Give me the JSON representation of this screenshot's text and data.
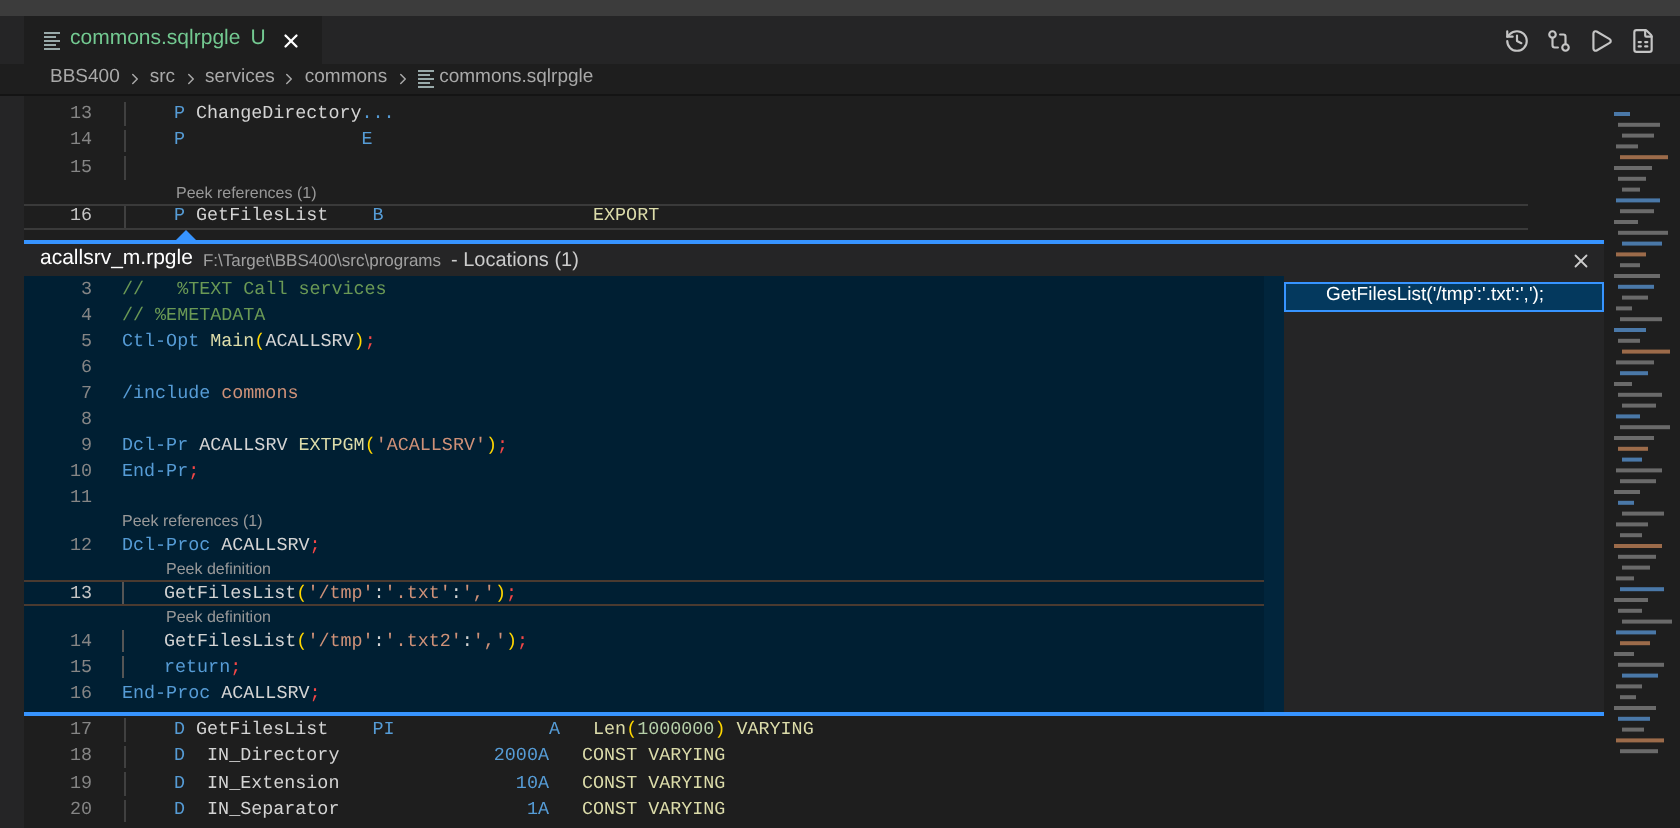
{
  "tab": {
    "title": "commons.sqlrpgle",
    "status": "U",
    "selected": true
  },
  "breadcrumb": [
    "BBS400",
    "src",
    "services",
    "commons",
    "commons.sqlrpgle"
  ],
  "editor_top": {
    "lines": [
      {
        "number": "13",
        "current": false,
        "tokens": [
          {
            "text": "P ",
            "kind": "keyword"
          },
          {
            "text": "ChangeDirectory",
            "kind": "name"
          },
          {
            "text": "...",
            "kind": "keyword"
          }
        ]
      },
      {
        "number": "14",
        "current": false,
        "tokens": [
          {
            "text": "P                E",
            "kind": "keyword"
          }
        ]
      },
      {
        "number": "15",
        "current": false
      },
      {
        "number": "16",
        "current": true,
        "lens": "Peek references (1)",
        "tokens": [
          {
            "text": "P ",
            "kind": "keyword"
          },
          {
            "text": "GetFilesList    ",
            "kind": "name"
          },
          {
            "text": "B",
            "kind": "keyword"
          },
          {
            "text": "                   EXPORT",
            "kind": "attr"
          }
        ]
      }
    ]
  },
  "peek": {
    "file": "acallsrv_m.rpgle",
    "path": "F:\\Target\\BBS400\\src\\programs",
    "title": "- Locations (1)",
    "lines": [
      {
        "number": "3",
        "current": false,
        "nested": false,
        "tokens": [
          {
            "text": "//   %TEXT Call services",
            "kind": "comment"
          }
        ]
      },
      {
        "number": "4",
        "current": false,
        "nested": false,
        "tokens": [
          {
            "text": "// %EMETADATA",
            "kind": "comment"
          }
        ]
      },
      {
        "number": "5",
        "current": false,
        "nested": false,
        "tokens": [
          {
            "text": "Ctl-Opt ",
            "kind": "keyword"
          },
          {
            "text": "Main",
            "kind": "func"
          },
          {
            "text": "(",
            "kind": "paren"
          },
          {
            "text": "ACALLSRV",
            "kind": "name"
          },
          {
            "text": ")",
            "kind": "paren"
          },
          {
            "text": ";",
            "kind": "semi"
          }
        ]
      },
      {
        "number": "6",
        "current": false,
        "nested": false
      },
      {
        "number": "7",
        "current": false,
        "nested": false,
        "tokens": [
          {
            "text": "/include ",
            "kind": "keyword"
          },
          {
            "text": "commons",
            "kind": "string"
          }
        ]
      },
      {
        "number": "8",
        "current": false,
        "nested": false
      },
      {
        "number": "9",
        "current": false,
        "nested": false,
        "tokens": [
          {
            "text": "Dcl-Pr ",
            "kind": "keyword"
          },
          {
            "text": "ACALLSRV ",
            "kind": "name"
          },
          {
            "text": "EXTPGM",
            "kind": "func"
          },
          {
            "text": "(",
            "kind": "paren"
          },
          {
            "text": "'ACALLSRV'",
            "kind": "string"
          },
          {
            "text": ")",
            "kind": "paren"
          },
          {
            "text": ";",
            "kind": "semi"
          }
        ]
      },
      {
        "number": "10",
        "current": false,
        "nested": false,
        "tokens": [
          {
            "text": "End-Pr",
            "kind": "keyword"
          },
          {
            "text": ";",
            "kind": "semi"
          }
        ]
      },
      {
        "number": "11",
        "current": false,
        "nested": false
      },
      {
        "number": "12",
        "current": false,
        "nested": false,
        "lens": "Peek references (1)",
        "tokens": [
          {
            "text": "Dcl-Proc ",
            "kind": "keyword"
          },
          {
            "text": "ACALLSRV",
            "kind": "name"
          },
          {
            "text": ";",
            "kind": "semi"
          }
        ]
      },
      {
        "number": "13",
        "current": true,
        "nested": true,
        "lens": "Peek definition",
        "tokens": [
          {
            "text": "GetFilesList",
            "kind": "name"
          },
          {
            "text": "(",
            "kind": "paren"
          },
          {
            "text": "'/tmp'",
            "kind": "string"
          },
          {
            "text": ":",
            "kind": "name"
          },
          {
            "text": "'.txt'",
            "kind": "string"
          },
          {
            "text": ":",
            "kind": "name"
          },
          {
            "text": "','",
            "kind": "string"
          },
          {
            "text": ")",
            "kind": "paren"
          },
          {
            "text": ";",
            "kind": "semi"
          }
        ]
      },
      {
        "number": "14",
        "current": false,
        "nested": true,
        "lens": "Peek definition",
        "tokens": [
          {
            "text": "GetFilesList",
            "kind": "name"
          },
          {
            "text": "(",
            "kind": "paren"
          },
          {
            "text": "'/tmp'",
            "kind": "string"
          },
          {
            "text": ":",
            "kind": "name"
          },
          {
            "text": "'.txt2'",
            "kind": "string"
          },
          {
            "text": ":",
            "kind": "name"
          },
          {
            "text": "','",
            "kind": "string"
          },
          {
            "text": ")",
            "kind": "paren"
          },
          {
            "text": ";",
            "kind": "semi"
          }
        ]
      },
      {
        "number": "15",
        "current": false,
        "nested": true,
        "tokens": [
          {
            "text": "return",
            "kind": "keyword"
          },
          {
            "text": ";",
            "kind": "semi"
          }
        ]
      },
      {
        "number": "16",
        "current": false,
        "nested": false,
        "tokens": [
          {
            "text": "End-Proc ",
            "kind": "keyword"
          },
          {
            "text": "ACALLSRV",
            "kind": "name"
          },
          {
            "text": ";",
            "kind": "semi"
          }
        ]
      }
    ],
    "results": [
      {
        "label": "GetFilesList('/tmp':'.txt':',');",
        "selected": true
      }
    ]
  },
  "editor_bottom": {
    "lines": [
      {
        "number": "17",
        "current": false,
        "tokens": [
          {
            "text": "D ",
            "kind": "keyword"
          },
          {
            "text": "GetFilesList    ",
            "kind": "name"
          },
          {
            "text": "PI              A   ",
            "kind": "keyword"
          },
          {
            "text": "Len",
            "kind": "func"
          },
          {
            "text": "(",
            "kind": "paren"
          },
          {
            "text": "1000000",
            "kind": "number"
          },
          {
            "text": ")",
            "kind": "paren"
          },
          {
            "text": " VARYING",
            "kind": "attr"
          }
        ]
      },
      {
        "number": "18",
        "current": false,
        "tokens": [
          {
            "text": "D  ",
            "kind": "keyword"
          },
          {
            "text": "IN_Directory",
            "kind": "name"
          },
          {
            "text": "              2000A   ",
            "kind": "keyword"
          },
          {
            "text": "CONST VARYING",
            "kind": "attr"
          }
        ]
      },
      {
        "number": "19",
        "current": false,
        "tokens": [
          {
            "text": "D  ",
            "kind": "keyword"
          },
          {
            "text": "IN_Extension",
            "kind": "name"
          },
          {
            "text": "                10A   ",
            "kind": "keyword"
          },
          {
            "text": "CONST VARYING",
            "kind": "attr"
          }
        ]
      },
      {
        "number": "20",
        "current": false,
        "tokens": [
          {
            "text": "D  ",
            "kind": "keyword"
          },
          {
            "text": "IN_Separator",
            "kind": "name"
          },
          {
            "text": "                 1A   ",
            "kind": "keyword"
          },
          {
            "text": "CONST VARYING",
            "kind": "attr"
          }
        ]
      }
    ]
  }
}
